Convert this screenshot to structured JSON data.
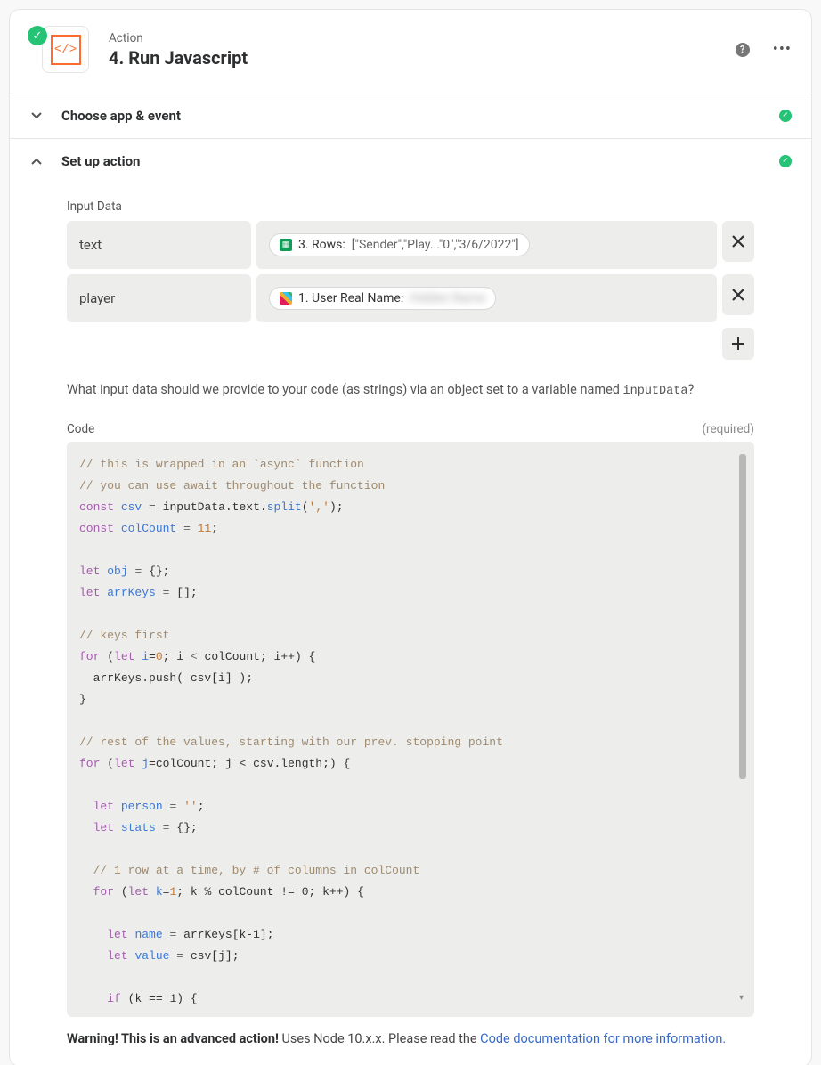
{
  "header": {
    "subtitle": "Action",
    "title": "4. Run Javascript",
    "app_icon_label": "</>"
  },
  "sections": {
    "choose": {
      "title": "Choose app & event"
    },
    "setup": {
      "title": "Set up action",
      "input_data_label": "Input Data",
      "rows": [
        {
          "key": "text",
          "pill_prefix": "3. Rows:",
          "pill_value": "[\"Sender\",\"Play...\"0\",\"3/6/2022\"]",
          "icon": "sheets"
        },
        {
          "key": "player",
          "pill_prefix": "1. User Real Name:",
          "pill_value": "Hidden Name",
          "icon": "slack",
          "blurred": true
        }
      ],
      "help_text_prefix": "What input data should we provide to your code (as strings) via an object set to a variable named ",
      "help_text_code": "inputData",
      "help_text_suffix": "?",
      "code_label": "Code",
      "required_label": "(required)"
    }
  },
  "code": {
    "line1_comment": "// this is wrapped in an `async` function",
    "line2_comment": "// you can use await throughout the function",
    "csv_decl": {
      "kw": "const",
      "name": "csv",
      "rhs_obj": "inputData.text.",
      "rhs_fn": "split",
      "rhs_arg": "','"
    },
    "colcount_decl": {
      "kw": "const",
      "name": "colCount",
      "val": "11"
    },
    "obj_decl": {
      "kw": "let",
      "name": "obj",
      "val": "{}"
    },
    "arr_decl": {
      "kw": "let",
      "name": "arrKeys",
      "val": "[]"
    },
    "keys_comment": "// keys first",
    "for1_kw": "for",
    "for1_let": "let",
    "for1_var": "i",
    "for1_init": "0",
    "for1_cond_op": "<",
    "for1_cond_rhs": "colCount",
    "for1_inc": "i++",
    "for1_body": "arrKeys.push( csv[i] );",
    "rest_comment": "// rest of the values, starting with our prev. stopping point",
    "for2_var": "j",
    "for2_init": "colCount",
    "for2_cond": "j < csv.length;",
    "person_kw": "let",
    "person_var": "person",
    "person_val": "''",
    "stats_var": "stats",
    "stats_val": "{}",
    "row_comment": "// 1 row at a time, by # of columns in colCount",
    "for3_var": "k",
    "for3_init": "1",
    "for3_cond": "k % colCount != 0",
    "for3_inc": "k++",
    "name_var": "name",
    "name_rhs": "arrKeys[k-1]",
    "value_var": "value",
    "value_rhs": "csv[j]",
    "if_cond": "k == 1"
  },
  "warning": {
    "strong": "Warning! This is an advanced action!",
    "text": " Uses Node 10.x.x. Please read the ",
    "link": "Code documentation for more information."
  }
}
